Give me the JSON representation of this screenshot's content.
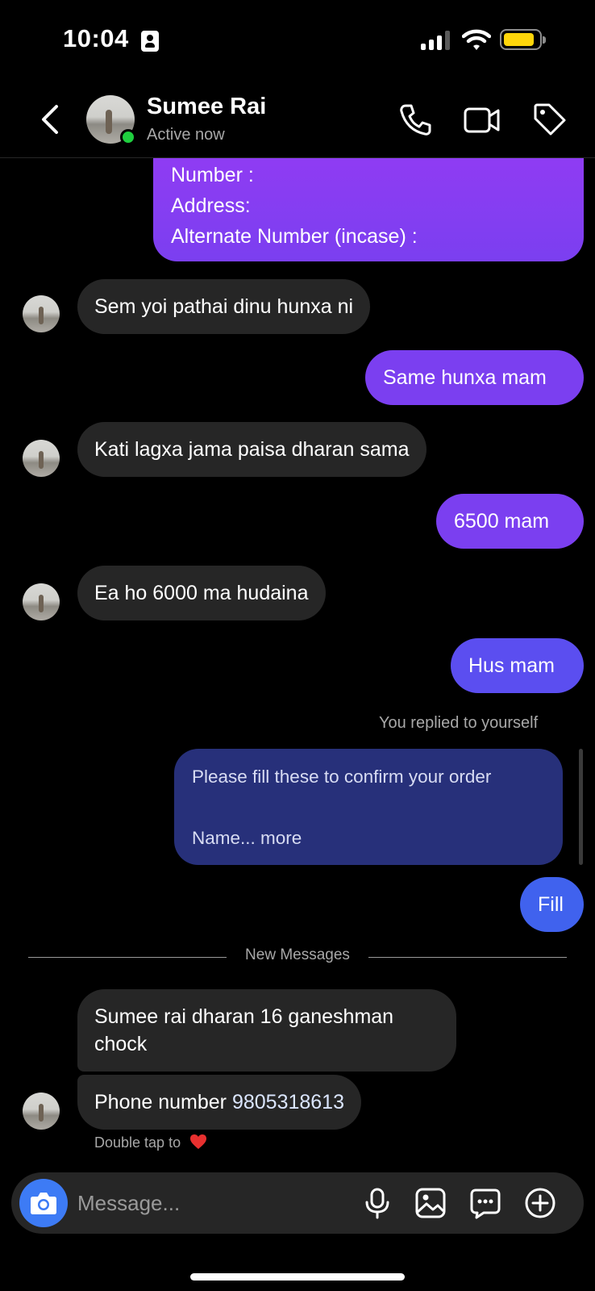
{
  "status_bar": {
    "time": "10:04"
  },
  "header": {
    "contact_name": "Sumee Rai",
    "contact_status": "Active now"
  },
  "messages": {
    "top_form_lines": [
      "Number :",
      "Address:",
      "Alternate Number (incase) :"
    ],
    "m1": "Sem yoi pathai dinu hunxa ni",
    "m2": "Same hunxa mam",
    "m3": "Kati lagxa jama paisa dharan sama",
    "m4": "6500 mam",
    "m5": "Ea ho 6000 ma hudaina",
    "m6": "Hus mam",
    "reply_note": "You replied to yourself",
    "reply_line1": "Please fill these to confirm your order",
    "reply_line2": "Name... more",
    "m7": "Fill",
    "new_messages_label": "New Messages",
    "m8_line1": "Sumee rai dharan 16 ganeshman",
    "m8_line2": "chock",
    "m9_prefix": "Phone number ",
    "m9_phone": "9805318613",
    "double_tap_hint": "Double tap to"
  },
  "composer": {
    "placeholder": "Message..."
  },
  "colors": {
    "sent_bubble": "#7b3ff0",
    "received_bubble": "#262626",
    "reply_bubble": "#27307a",
    "camera_button": "#3d7bf5",
    "online": "#1fcf3f"
  },
  "icons": [
    "back-icon",
    "phone-icon",
    "video-icon",
    "tag-icon",
    "camera-icon",
    "microphone-icon",
    "gallery-icon",
    "sticker-icon",
    "plus-icon",
    "heart-icon"
  ]
}
